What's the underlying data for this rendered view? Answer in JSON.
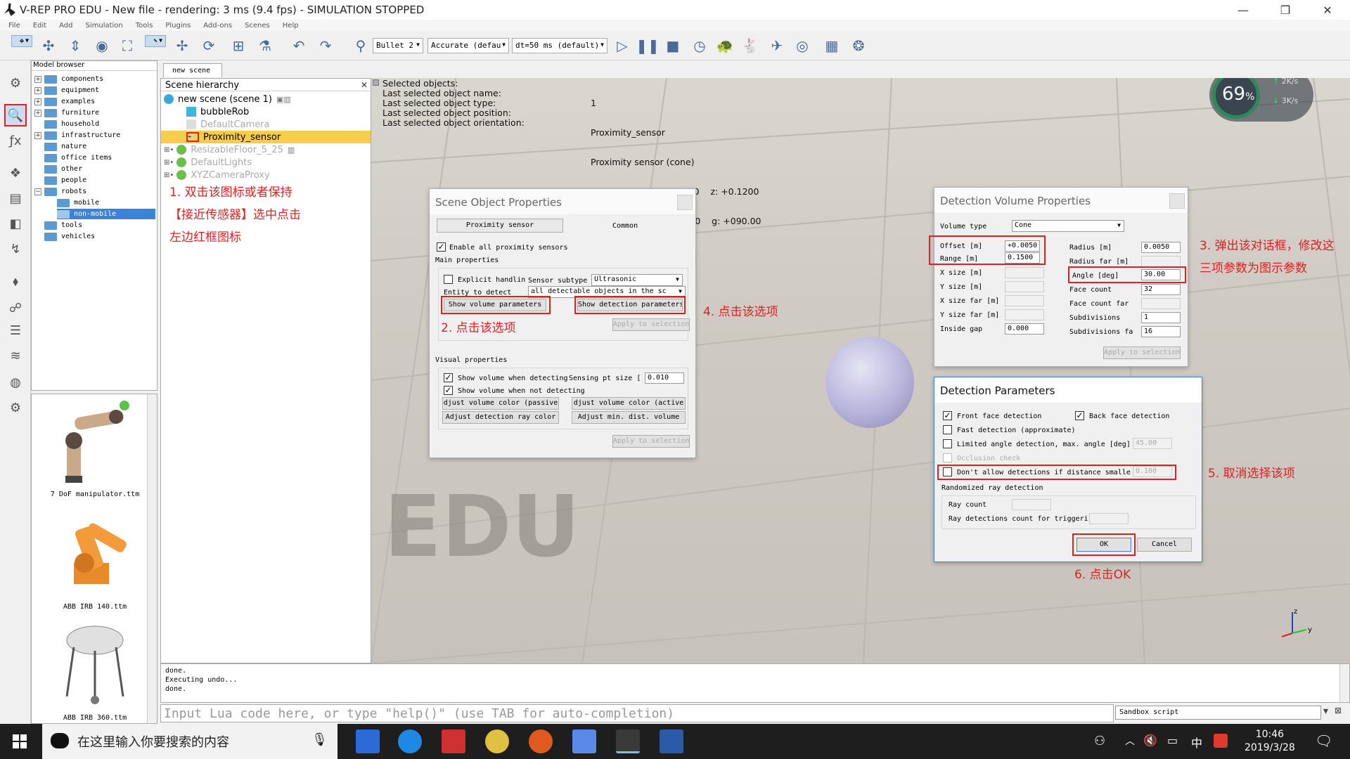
{
  "window": {
    "title": "V-REP PRO EDU - New file - rendering: 3 ms (9.4 fps) - SIMULATION STOPPED",
    "controls": {
      "minimize": "—",
      "maximize": "❐",
      "close": "✕"
    }
  },
  "menu": [
    "File",
    "Edit",
    "Add",
    "Simulation",
    "Tools",
    "Plugins",
    "Add-ons",
    "Scenes",
    "Help"
  ],
  "toolbar": {
    "engine": "Bullet 2",
    "accuracy": "Accurate (defau",
    "timestep": "dt=50 ms (default)"
  },
  "model_browser": {
    "header": "Model browser",
    "items": [
      {
        "label": "components",
        "expand": "+"
      },
      {
        "label": "equipment",
        "expand": "+"
      },
      {
        "label": "examples",
        "expand": "+"
      },
      {
        "label": "furniture",
        "expand": "+"
      },
      {
        "label": "household",
        "expand": ""
      },
      {
        "label": "infrastructure",
        "expand": "+"
      },
      {
        "label": "nature",
        "expand": ""
      },
      {
        "label": "office items",
        "expand": ""
      },
      {
        "label": "other",
        "expand": ""
      },
      {
        "label": "people",
        "expand": ""
      },
      {
        "label": "robots",
        "expand": "−"
      },
      {
        "label": "mobile",
        "expand": ""
      },
      {
        "label": "non-mobile",
        "expand": ""
      },
      {
        "label": "tools",
        "expand": ""
      },
      {
        "label": "vehicles",
        "expand": ""
      }
    ],
    "thumbnails": [
      "7 DoF manipulator.ttm",
      "ABB IRB 140.ttm",
      "ABB IRB 360.ttm"
    ]
  },
  "scene_tab": "new scene",
  "hierarchy": {
    "header": "Scene hierarchy",
    "root": "new scene (scene 1)",
    "items": [
      "bubbleRob",
      "DefaultCamera",
      "Proximity_sensor",
      "ResizableFloor_5_25",
      "DefaultLights",
      "XYZCameraProxy"
    ]
  },
  "selection_info": {
    "labels": [
      "Selected objects:",
      "Last selected object name:",
      "Last selected object type:",
      "Last selected object position:",
      "Last selected object orientation:"
    ],
    "values": [
      "1",
      "Proximity_sensor",
      "Proximity sensor (cone)",
      "x: +0.1000    y: +0.0000    z: +0.1200",
      "a: +000.00    b: +090.00    g: +090.00"
    ]
  },
  "annotations": {
    "a1": "1. 双击该图标或者保持【接近传感器】选中点击左边红框图标",
    "a2": "2. 点击该选项",
    "a3": "3. 弹出该对话框，修改这三项参数为图示参数",
    "a4": "4. 点击该选项",
    "a5": "5. 取消选择该项",
    "a6": "6. 点击OK"
  },
  "scene_object_properties": {
    "title": "Scene Object Properties",
    "tab_proximity": "Proximity sensor",
    "tab_common": "Common",
    "enable_all": "Enable all proximity sensors",
    "main_properties": "Main properties",
    "explicit_handling": "Explicit handlin",
    "sensor_subtype_label": "Sensor subtype",
    "sensor_subtype_value": "Ultrasonic",
    "entity_label": "Entity to detect",
    "entity_value": "all detectable objects in the sc",
    "show_volume_params": "Show volume parameters",
    "show_detection_params": "Show detection parameters",
    "apply": "Apply to selection",
    "visual_properties": "Visual properties",
    "show_volume_detecting": "Show volume when detecting",
    "sensing_pt_size_label": "Sensing pt size [",
    "sensing_pt_size_value": "0.010",
    "show_volume_not": "Show volume when not detecting",
    "adj_passive": "djust volume color (passive",
    "adj_active": "djust volume color (active",
    "adj_ray": "Adjust detection ray color",
    "adj_min": "Adjust min. dist. volume",
    "apply2": "Apply to selection"
  },
  "detection_volume": {
    "title": "Detection Volume Properties",
    "volume_type_label": "Volume type",
    "volume_type_value": "Cone",
    "offset_label": "Offset [m]",
    "offset_value": "+0.0050",
    "range_label": "Range [m]",
    "range_value": "0.1500",
    "xsize_label": "X size [m]",
    "ysize_label": "Y size [m]",
    "xsizefar_label": "X size far [m]",
    "ysizefar_label": "Y size far [m]",
    "inside_gap_label": "Inside gap",
    "inside_gap_value": "0.000",
    "radius_label": "Radius [m]",
    "radius_value": "0.0050",
    "radius_far_label": "Radius far [m]",
    "angle_label": "Angle [deg]",
    "angle_value": "30.00",
    "face_count_label": "Face count",
    "face_count_value": "32",
    "face_count_far_label": "Face count far",
    "subdivisions_label": "Subdivisions",
    "subdivisions_value": "1",
    "subdivisions_far_label": "Subdivisions fa",
    "subdivisions_far_value": "16",
    "apply": "Apply to selection"
  },
  "detection_parameters": {
    "title": "Detection Parameters",
    "front_face": "Front face detection",
    "back_face": "Back face detection",
    "fast_detection": "Fast detection (approximate)",
    "limited_angle": "Limited angle detection, max. angle [deg]",
    "limited_angle_value": "45.00",
    "occlusion": "Occlusion check",
    "dont_allow": "Don't allow detections if distance smalle",
    "dont_allow_value": "0.100",
    "randomized": "Randomized ray detection",
    "ray_count": "Ray count",
    "ray_trigger": "Ray detections count for triggeri",
    "ok": "OK",
    "cancel": "Cancel"
  },
  "viewport": {
    "watermark": "EDU",
    "perf_percent": "69",
    "perf_unit": "%",
    "net_up": "2K/s",
    "net_down": "3K/s",
    "prox_label": "Pr",
    "axis_z": "z",
    "axis_y": "y",
    "axis_x": "x"
  },
  "console": [
    "done.",
    "Executing undo...",
    "done."
  ],
  "lua_placeholder": "Input Lua code here, or type \"help()\" (use TAB for auto-completion)",
  "script_type": "Sandbox script",
  "taskbar": {
    "search_placeholder": "在这里输入你要搜索的内容",
    "time": "10:46",
    "date": "2019/3/28",
    "ime": "中"
  }
}
